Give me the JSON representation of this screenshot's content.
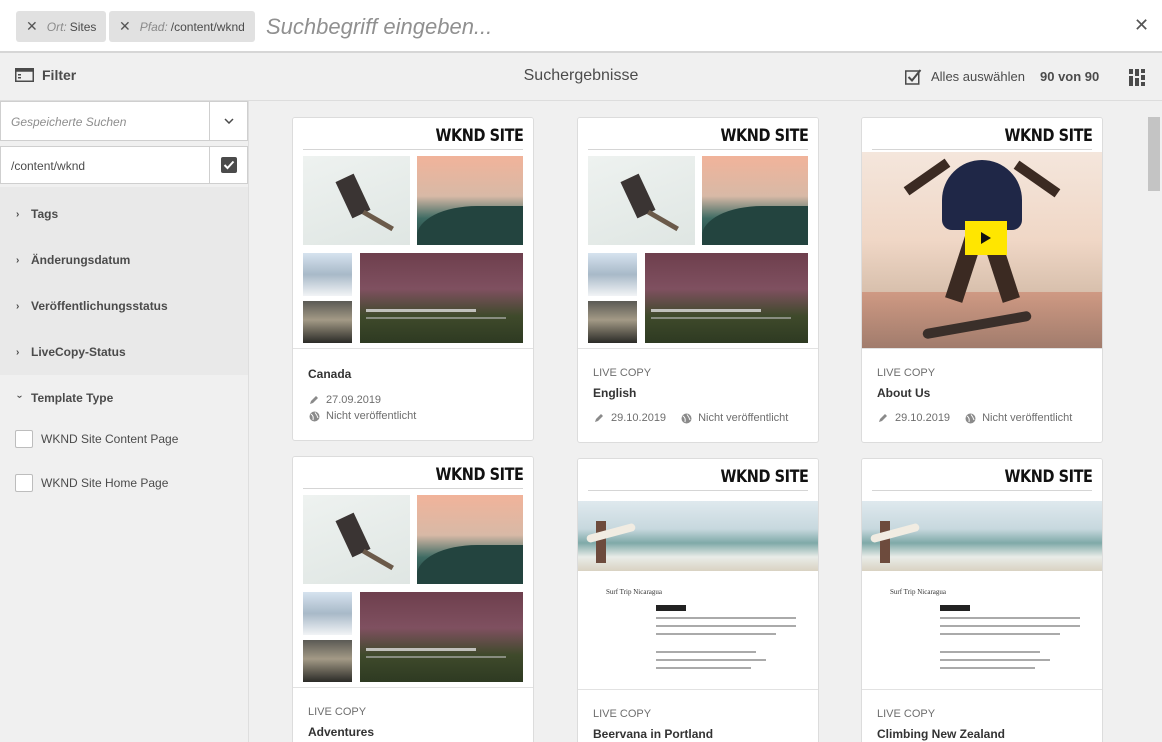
{
  "search": {
    "chips": [
      {
        "key": "Ort:",
        "value": "Sites"
      },
      {
        "key": "Pfad:",
        "value": "/content/wknd"
      }
    ],
    "placeholder": "Suchbegriff eingeben..."
  },
  "actionbar": {
    "filter_label": "Filter",
    "title": "Suchergebnisse",
    "select_all_label": "Alles auswählen",
    "count": "90 von 90"
  },
  "rail": {
    "saved_searches_placeholder": "Gespeicherte Suchen",
    "path_value": "/content/wknd",
    "facets": [
      "Tags",
      "Änderungsdatum",
      "Veröffentlichungsstatus",
      "LiveCopy-Status"
    ],
    "template_type_label": "Template Type",
    "template_options": [
      "WKND Site Content Page",
      "WKND Site Home Page"
    ]
  },
  "cards": [
    {
      "brand": "WKND SITE",
      "type": "",
      "title": "Canada",
      "date": "27.09.2019",
      "status": "Nicht veröffentlicht"
    },
    {
      "brand": "WKND SITE",
      "type": "LIVE COPY",
      "title": "English",
      "date": "29.10.2019",
      "status": "Nicht veröffentlicht"
    },
    {
      "brand": "WKND SITE",
      "type": "LIVE COPY",
      "title": "About Us",
      "date": "29.10.2019",
      "status": "Nicht veröffentlicht"
    },
    {
      "brand": "WKND SITE",
      "type": "LIVE COPY",
      "title": "Adventures",
      "date": "",
      "status": ""
    },
    {
      "brand": "WKND SITE",
      "type": "LIVE COPY",
      "title": "Beervana in Portland",
      "date": "",
      "status": ""
    },
    {
      "brand": "WKND SITE",
      "type": "LIVE COPY",
      "title": "Climbing New Zealand",
      "date": "",
      "status": ""
    }
  ],
  "thumb_text": {
    "article_heading": "Surf Trip Nicaragua",
    "feature_caption": "Western Australia by Camper Van"
  },
  "colors": {
    "accent_yellow": "#ffe600",
    "panel_bg": "#f0f0f0",
    "card_bg": "#ffffff"
  }
}
